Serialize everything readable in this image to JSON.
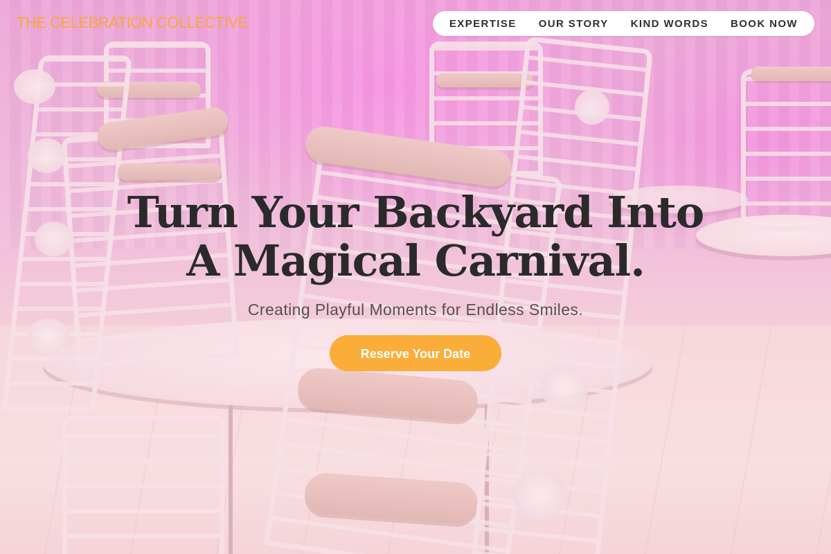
{
  "brand": {
    "name": "THE CELEBRATION COLLECTIVE",
    "color": "#f6a83a"
  },
  "nav": {
    "items": [
      {
        "label": "EXPERTISE"
      },
      {
        "label": "OUR STORY"
      },
      {
        "label": "KIND WORDS"
      },
      {
        "label": "BOOK NOW"
      }
    ]
  },
  "hero": {
    "headline_line1": "Turn Your Backyard Into",
    "headline_line2": "A Magical Carnival.",
    "tagline": "Creating Playful Moments for Endless Smiles.",
    "cta_label": "Reserve Your Date",
    "cta_color": "#fbad3a",
    "background": "event hall with stacked white chairs and round tables under pink lighting"
  }
}
